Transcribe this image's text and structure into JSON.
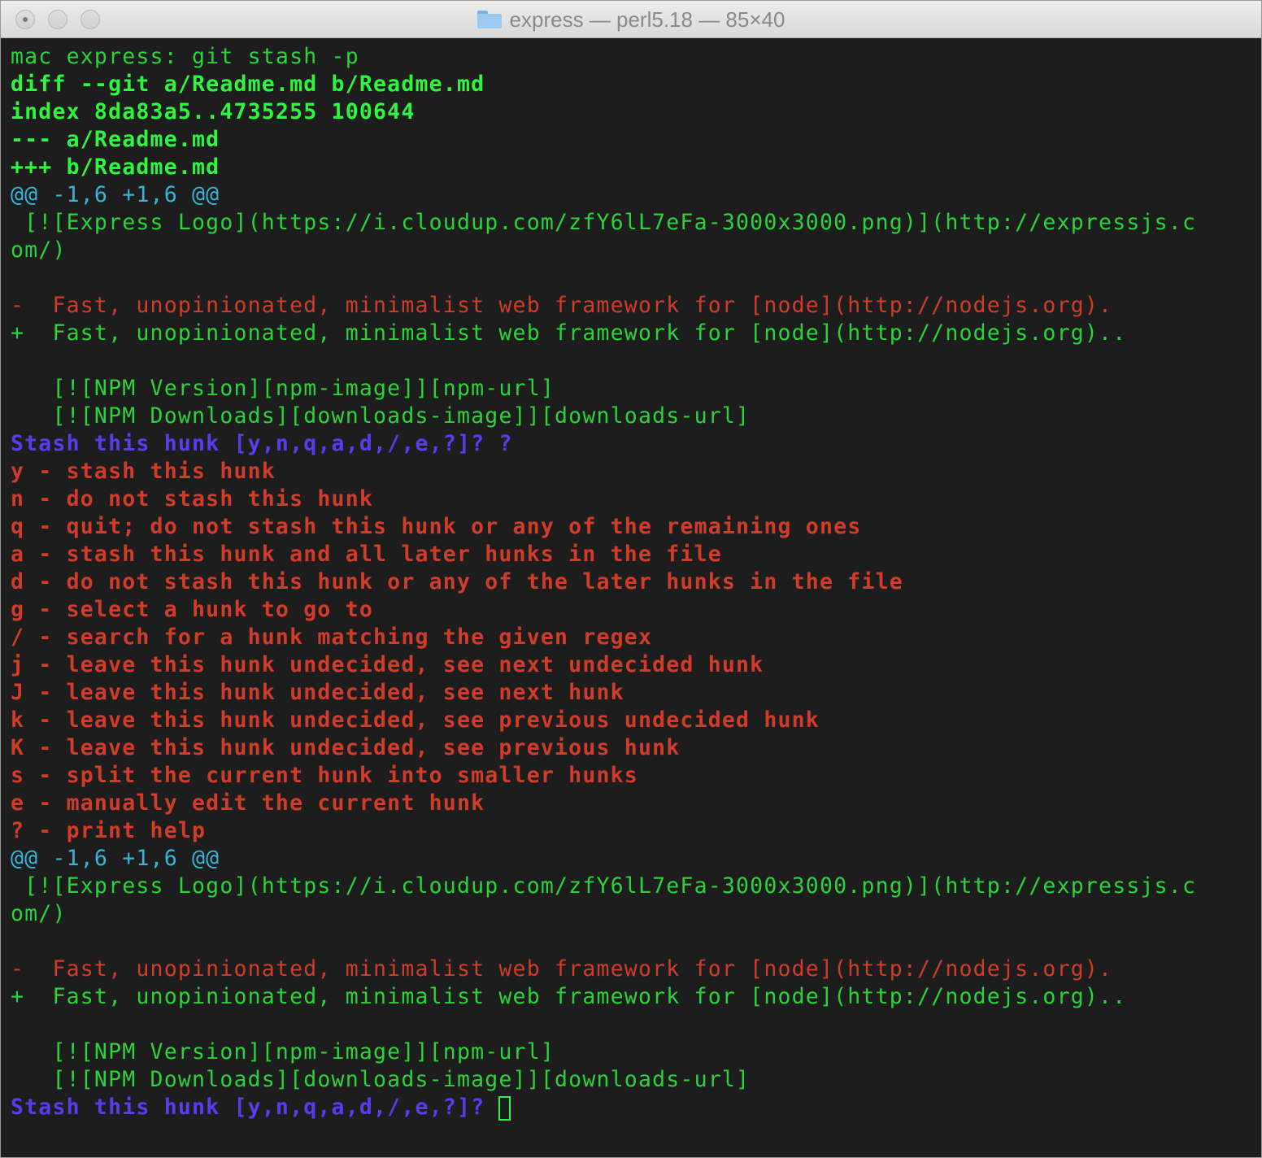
{
  "window": {
    "title": "express — perl5.18 — 85×40",
    "icon": "folder-icon"
  },
  "colors": {
    "background": "#1d1d1d",
    "green": "#2ef53f",
    "cyan": "#35b6d6",
    "red": "#d13c2a",
    "blue": "#5a3cf0"
  },
  "terminal": {
    "lines": [
      {
        "text": "mac express: git stash -p",
        "color": "dgreen",
        "bold": false
      },
      {
        "text": "diff --git a/Readme.md b/Readme.md",
        "color": "green",
        "bold": true
      },
      {
        "text": "index 8da83a5..4735255 100644",
        "color": "green",
        "bold": true
      },
      {
        "text": "--- a/Readme.md",
        "color": "green",
        "bold": true
      },
      {
        "text": "+++ b/Readme.md",
        "color": "green",
        "bold": true
      },
      {
        "text": "@@ -1,6 +1,6 @@",
        "color": "cyan",
        "bold": false
      },
      {
        "text": " [![Express Logo](https://i.cloudup.com/zfY6lL7eFa-3000x3000.png)](http://expressjs.c",
        "color": "dgreen",
        "bold": false
      },
      {
        "text": "om/)",
        "color": "dgreen",
        "bold": false
      },
      {
        "text": "",
        "color": "dgreen",
        "bold": false
      },
      {
        "text": "-  Fast, unopinionated, minimalist web framework for [node](http://nodejs.org).",
        "color": "red",
        "bold": false
      },
      {
        "text": "+  Fast, unopinionated, minimalist web framework for [node](http://nodejs.org)..",
        "color": "dgreen",
        "bold": false
      },
      {
        "text": "",
        "color": "dgreen",
        "bold": false
      },
      {
        "text": "   [![NPM Version][npm-image]][npm-url]",
        "color": "dgreen",
        "bold": false
      },
      {
        "text": "   [![NPM Downloads][downloads-image]][downloads-url]",
        "color": "dgreen",
        "bold": false
      },
      {
        "text": "Stash this hunk [y,n,q,a,d,/,e,?]? ?",
        "color": "blue",
        "bold": true
      },
      {
        "text": "y - stash this hunk",
        "color": "red",
        "bold": true
      },
      {
        "text": "n - do not stash this hunk",
        "color": "red",
        "bold": true
      },
      {
        "text": "q - quit; do not stash this hunk or any of the remaining ones",
        "color": "red",
        "bold": true
      },
      {
        "text": "a - stash this hunk and all later hunks in the file",
        "color": "red",
        "bold": true
      },
      {
        "text": "d - do not stash this hunk or any of the later hunks in the file",
        "color": "red",
        "bold": true
      },
      {
        "text": "g - select a hunk to go to",
        "color": "red",
        "bold": true
      },
      {
        "text": "/ - search for a hunk matching the given regex",
        "color": "red",
        "bold": true
      },
      {
        "text": "j - leave this hunk undecided, see next undecided hunk",
        "color": "red",
        "bold": true
      },
      {
        "text": "J - leave this hunk undecided, see next hunk",
        "color": "red",
        "bold": true
      },
      {
        "text": "k - leave this hunk undecided, see previous undecided hunk",
        "color": "red",
        "bold": true
      },
      {
        "text": "K - leave this hunk undecided, see previous hunk",
        "color": "red",
        "bold": true
      },
      {
        "text": "s - split the current hunk into smaller hunks",
        "color": "red",
        "bold": true
      },
      {
        "text": "e - manually edit the current hunk",
        "color": "red",
        "bold": true
      },
      {
        "text": "? - print help",
        "color": "red",
        "bold": true
      },
      {
        "text": "@@ -1,6 +1,6 @@",
        "color": "cyan",
        "bold": false
      },
      {
        "text": " [![Express Logo](https://i.cloudup.com/zfY6lL7eFa-3000x3000.png)](http://expressjs.c",
        "color": "dgreen",
        "bold": false
      },
      {
        "text": "om/)",
        "color": "dgreen",
        "bold": false
      },
      {
        "text": "",
        "color": "dgreen",
        "bold": false
      },
      {
        "text": "-  Fast, unopinionated, minimalist web framework for [node](http://nodejs.org).",
        "color": "red",
        "bold": false
      },
      {
        "text": "+  Fast, unopinionated, minimalist web framework for [node](http://nodejs.org)..",
        "color": "dgreen",
        "bold": false
      },
      {
        "text": "",
        "color": "dgreen",
        "bold": false
      },
      {
        "text": "   [![NPM Version][npm-image]][npm-url]",
        "color": "dgreen",
        "bold": false
      },
      {
        "text": "   [![NPM Downloads][downloads-image]][downloads-url]",
        "color": "dgreen",
        "bold": false
      },
      {
        "text": "Stash this hunk [y,n,q,a,d,/,e,?]? ",
        "color": "blue",
        "bold": true,
        "cursor": true
      }
    ]
  }
}
